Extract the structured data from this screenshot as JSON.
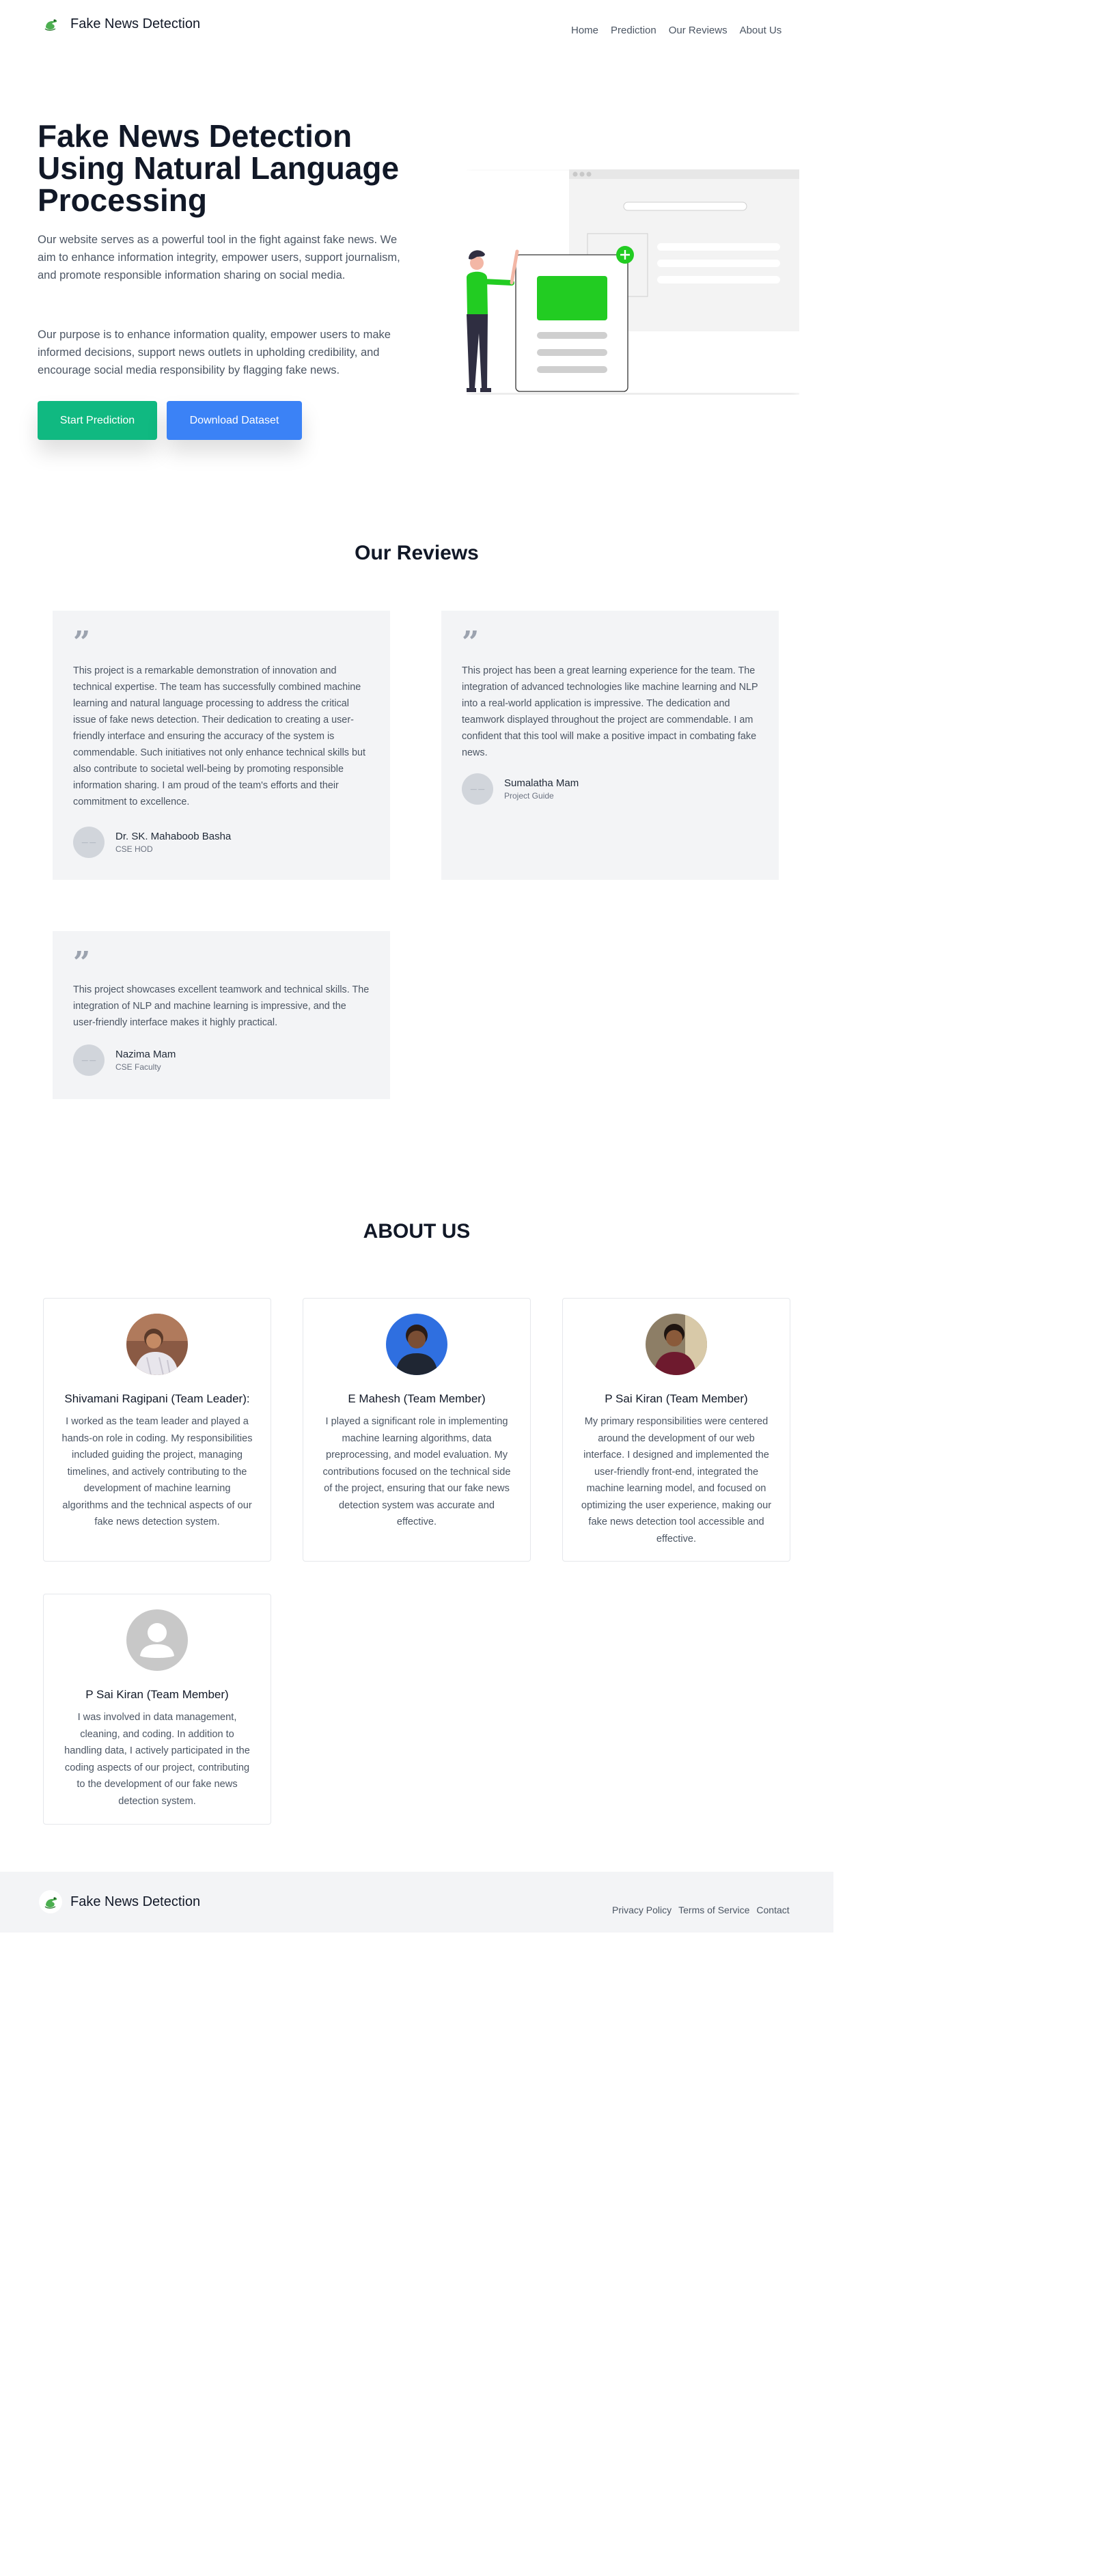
{
  "header": {
    "logo_text": "Fake News Detection",
    "nav": [
      "Home",
      "Prediction",
      "Our Reviews",
      "About Us"
    ]
  },
  "hero": {
    "title": "Fake News Detection Using Natural Language Processing",
    "paragraph1": "Our website serves as a powerful tool in the fight against fake news. We aim to enhance information integrity, empower users, support journalism, and promote responsible information sharing on social media.",
    "paragraph2": "Our purpose is to enhance information quality, empower users to make informed decisions, support news outlets in upholding credibility, and encourage social media responsibility by flagging fake news.",
    "btn_primary": "Start Prediction",
    "btn_secondary": "Download Dataset"
  },
  "reviews": {
    "title": "Our Reviews",
    "items": [
      {
        "text": "This project is a remarkable demonstration of innovation and technical expertise. The team has successfully combined machine learning and natural language processing to address the critical issue of fake news detection. Their dedication to creating a user-friendly interface and ensuring the accuracy of the system is commendable. Such initiatives not only enhance technical skills but also contribute to societal well-being by promoting responsible information sharing. I am proud of the team's efforts and their commitment to excellence.",
        "name": "Dr. SK. Mahaboob Basha",
        "role": "CSE HOD"
      },
      {
        "text": "This project has been a great learning experience for the team. The integration of advanced technologies like machine learning and NLP into a real-world application is impressive. The dedication and teamwork displayed throughout the project are commendable. I am confident that this tool will make a positive impact in combating fake news.",
        "name": "Sumalatha Mam",
        "role": "Project Guide"
      },
      {
        "text": "This project showcases excellent teamwork and technical skills. The integration of NLP and machine learning is impressive, and the user-friendly interface makes it highly practical.",
        "name": "Nazima Mam",
        "role": "CSE Faculty"
      }
    ]
  },
  "about": {
    "title": "ABOUT US",
    "members": [
      {
        "name": "Shivamani Ragipani (Team Leader):",
        "desc": "I worked as the team leader and played a hands-on role in coding. My responsibilities included guiding the project, managing timelines, and actively contributing to the development of machine learning algorithms and the technical aspects of our fake news detection system."
      },
      {
        "name": "E Mahesh (Team Member)",
        "desc": "I played a significant role in implementing machine learning algorithms, data preprocessing, and model evaluation. My contributions focused on the technical side of the project, ensuring that our fake news detection system was accurate and effective."
      },
      {
        "name": "P Sai Kiran (Team Member)",
        "desc": "My primary responsibilities were centered around the development of our web interface. I designed and implemented the user-friendly front-end, integrated the machine learning model, and focused on optimizing the user experience, making our fake news detection tool accessible and effective."
      },
      {
        "name": "P Sai Kiran (Team Member)",
        "desc": "I was involved in data management, cleaning, and coding. In addition to handling data, I actively participated in the coding aspects of our project, contributing to the development of our fake news detection system."
      }
    ]
  },
  "footer": {
    "logo_text": "Fake News Detection",
    "links": [
      "Privacy Policy",
      "Terms of Service",
      "Contact"
    ]
  },
  "colors": {
    "accent_green": "#10b981",
    "accent_blue": "#3b82f6",
    "illustration_green": "#22cc22"
  }
}
